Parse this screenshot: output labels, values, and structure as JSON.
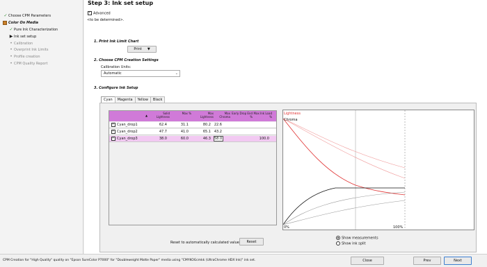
{
  "sidebar": {
    "items": [
      {
        "label": "Choose CPM Parameters",
        "icon": "checkmark-icon",
        "state": "done"
      },
      {
        "label": "Color On Media",
        "icon": "book-icon",
        "state": "active-section"
      },
      {
        "label": "Pure Ink Characterization",
        "icon": "checkmark-icon",
        "state": "done"
      },
      {
        "label": "Ink set setup",
        "icon": "arrow-right-icon",
        "state": "current"
      },
      {
        "label": "Calibration",
        "icon": "dot-icon",
        "state": "pending"
      },
      {
        "label": "Overprint Ink Limits",
        "icon": "dot-icon",
        "state": "pending"
      },
      {
        "label": "Profile creation",
        "icon": "dot-icon",
        "state": "pending"
      },
      {
        "label": "CPM Quality Report",
        "icon": "dot-icon",
        "state": "pending"
      }
    ]
  },
  "main": {
    "title": "Step 3: Ink set setup",
    "advanced_label": "Advanced",
    "advanced_checked": true,
    "tbd_text": "<to be determined>.",
    "section1": "1. Print Ink Limit Chart",
    "print_label": "Print",
    "section2": "2. Choose CPM Creation Settings",
    "calib_units_label": "Calibration Units:",
    "calib_units_value": "Automatic",
    "section3": "3. Configure Ink Setup",
    "tabs": [
      "Cyan",
      "Magenta",
      "Yellow",
      "Black"
    ],
    "active_tab": "Cyan"
  },
  "grid": {
    "headers": [
      "Solid Lightness",
      "Max %",
      "Max Lightness",
      "Max Chroma",
      "Early Drop End %",
      "Max Ink Load %"
    ],
    "rows": [
      {
        "name": "Cyan_drop1",
        "checked": true,
        "vals": [
          "62.4",
          "31.1",
          "80.2",
          "22.6",
          "",
          ""
        ],
        "selected": false
      },
      {
        "name": "Cyan_drop2",
        "checked": true,
        "vals": [
          "47.7",
          "41.0",
          "65.1",
          "43.2",
          "",
          ""
        ],
        "selected": false
      },
      {
        "name": "Cyan_drop3",
        "checked": true,
        "vals": [
          "38.0",
          "60.0",
          "46.3",
          "58.0",
          "",
          "100.0"
        ],
        "selected": true
      }
    ]
  },
  "plot": {
    "legend_lightness": "Lightness",
    "legend_chroma": "Chroma",
    "axis_start": "0%",
    "axis_end": "100%",
    "colors": {
      "lightness": "#e03030",
      "lightness_light": "#f09a9a",
      "chroma": "#111111",
      "chroma_light": "#999999"
    }
  },
  "reset": {
    "label": "Reset to automatically calculated values:",
    "button": "Reset"
  },
  "view_options": {
    "show_measurements": "Show measurements",
    "show_ink_split": "Show ink split",
    "selected": "show_measurements"
  },
  "footer": {
    "status": "CPM Creation for \"High Quality\" quality on \"Epson SureColor P7000\" for \"Doubleweight Matte Paper\" media using \"CMYKOGcmkk (UltraChrome HDX Ink)\" ink set.",
    "close": "Close",
    "prev": "Prev",
    "next": "Next"
  }
}
